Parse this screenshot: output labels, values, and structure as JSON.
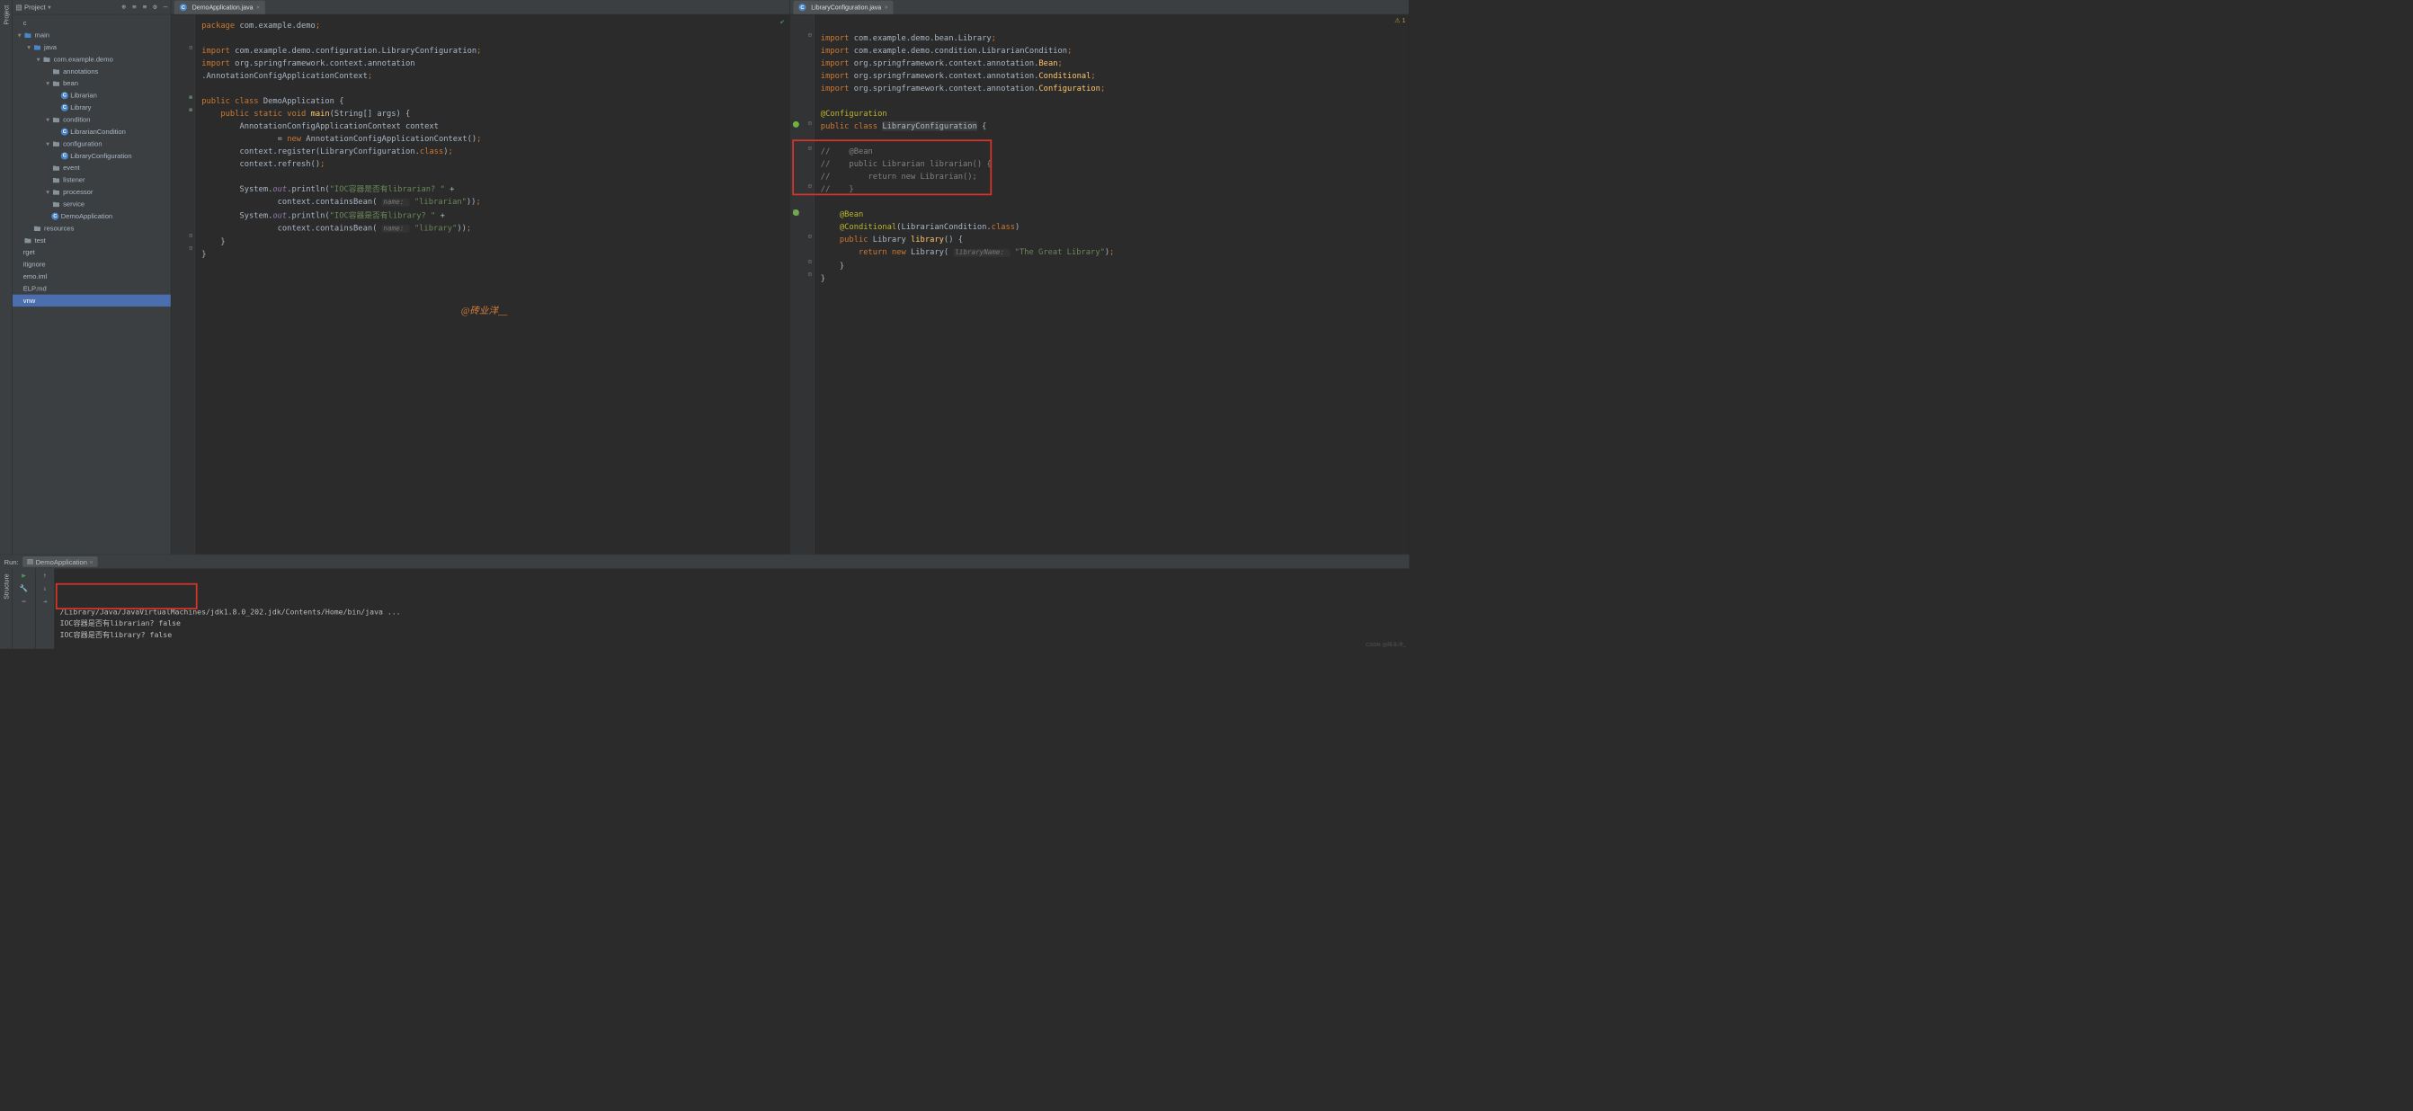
{
  "project": {
    "label": "Project",
    "tree": [
      {
        "indent": 0,
        "arrow": "",
        "icon": "",
        "label": "c"
      },
      {
        "indent": 0,
        "arrow": "▾",
        "icon": "folder-blue",
        "label": "main"
      },
      {
        "indent": 1,
        "arrow": "▾",
        "icon": "folder-blue",
        "label": "java"
      },
      {
        "indent": 2,
        "arrow": "▾",
        "icon": "folder",
        "label": "com.example.demo"
      },
      {
        "indent": 3,
        "arrow": "",
        "icon": "folder",
        "label": "annotations"
      },
      {
        "indent": 3,
        "arrow": "▾",
        "icon": "folder",
        "label": "bean"
      },
      {
        "indent": 4,
        "arrow": "",
        "icon": "class",
        "label": "Librarian"
      },
      {
        "indent": 4,
        "arrow": "",
        "icon": "class",
        "label": "Library"
      },
      {
        "indent": 3,
        "arrow": "▾",
        "icon": "folder",
        "label": "condition"
      },
      {
        "indent": 4,
        "arrow": "",
        "icon": "class",
        "label": "LibrarianCondition"
      },
      {
        "indent": 3,
        "arrow": "▾",
        "icon": "folder",
        "label": "configuration"
      },
      {
        "indent": 4,
        "arrow": "",
        "icon": "class",
        "label": "LibraryConfiguration"
      },
      {
        "indent": 3,
        "arrow": "",
        "icon": "folder",
        "label": "event"
      },
      {
        "indent": 3,
        "arrow": "",
        "icon": "folder",
        "label": "listener"
      },
      {
        "indent": 3,
        "arrow": "▾",
        "icon": "folder",
        "label": "processor"
      },
      {
        "indent": 3,
        "arrow": "",
        "icon": "folder",
        "label": "service"
      },
      {
        "indent": 3,
        "arrow": "",
        "icon": "class",
        "label": "DemoApplication"
      },
      {
        "indent": 1,
        "arrow": "",
        "icon": "folder",
        "label": "resources"
      },
      {
        "indent": 0,
        "arrow": "",
        "icon": "folder",
        "label": "test"
      },
      {
        "indent": 0,
        "arrow": "",
        "icon": "",
        "label": "rget"
      },
      {
        "indent": 0,
        "arrow": "",
        "icon": "",
        "label": "itignore"
      },
      {
        "indent": 0,
        "arrow": "",
        "icon": "",
        "label": "emo.iml"
      },
      {
        "indent": 0,
        "arrow": "",
        "icon": "",
        "label": "ELP.md"
      },
      {
        "indent": 0,
        "arrow": "",
        "icon": "",
        "label": "vnw",
        "selected": true
      }
    ]
  },
  "tabs": {
    "left": "DemoApplication.java",
    "right": "LibraryConfiguration.java"
  },
  "editor_left": {
    "lines": [
      [
        {
          "t": "package ",
          "c": "kw"
        },
        {
          "t": "com.example.demo",
          "c": ""
        },
        {
          "t": ";",
          "c": "kw"
        }
      ],
      [],
      [
        {
          "t": "import ",
          "c": "kw"
        },
        {
          "t": "com.example.demo.configuration.LibraryConfiguration",
          "c": ""
        },
        {
          "t": ";",
          "c": "kw"
        }
      ],
      [
        {
          "t": "import ",
          "c": "kw"
        },
        {
          "t": "org.springframework.context.annotation",
          "c": ""
        }
      ],
      [
        {
          "t": ".AnnotationConfigApplicationContext",
          "c": ""
        },
        {
          "t": ";",
          "c": "kw"
        }
      ],
      [],
      [
        {
          "t": "public class ",
          "c": "kw"
        },
        {
          "t": "DemoApplication {",
          "c": ""
        }
      ],
      [
        {
          "t": "    public static void ",
          "c": "kw"
        },
        {
          "t": "main",
          "c": "fn"
        },
        {
          "t": "(String[] args) {",
          "c": ""
        }
      ],
      [
        {
          "t": "        AnnotationConfigApplicationContext context",
          "c": ""
        }
      ],
      [
        {
          "t": "                = ",
          "c": ""
        },
        {
          "t": "new ",
          "c": "kw"
        },
        {
          "t": "AnnotationConfigApplicationContext()",
          "c": ""
        },
        {
          "t": ";",
          "c": "kw"
        }
      ],
      [
        {
          "t": "        context.register(LibraryConfiguration.",
          "c": ""
        },
        {
          "t": "class",
          "c": "kw"
        },
        {
          "t": ")",
          "c": ""
        },
        {
          "t": ";",
          "c": "kw"
        }
      ],
      [
        {
          "t": "        context.refresh()",
          "c": ""
        },
        {
          "t": ";",
          "c": "kw"
        }
      ],
      [],
      [
        {
          "t": "        System.",
          "c": ""
        },
        {
          "t": "out",
          "c": "field-it"
        },
        {
          "t": ".println(",
          "c": ""
        },
        {
          "t": "\"IOC容器是否有librarian? \" ",
          "c": "str"
        },
        {
          "t": "+",
          "c": ""
        }
      ],
      [
        {
          "t": "                context.containsBean( ",
          "c": ""
        },
        {
          "t": "name: ",
          "c": "hint"
        },
        {
          "t": " ",
          "c": ""
        },
        {
          "t": "\"librarian\"",
          "c": "str"
        },
        {
          "t": "))",
          "c": ""
        },
        {
          "t": ";",
          "c": "kw"
        }
      ],
      [
        {
          "t": "        System.",
          "c": ""
        },
        {
          "t": "out",
          "c": "field-it"
        },
        {
          "t": ".println(",
          "c": ""
        },
        {
          "t": "\"IOC容器是否有library? \" ",
          "c": "str"
        },
        {
          "t": "+",
          "c": ""
        }
      ],
      [
        {
          "t": "                context.containsBean( ",
          "c": ""
        },
        {
          "t": "name: ",
          "c": "hint"
        },
        {
          "t": " ",
          "c": ""
        },
        {
          "t": "\"library\"",
          "c": "str"
        },
        {
          "t": "))",
          "c": ""
        },
        {
          "t": ";",
          "c": "kw"
        }
      ],
      [
        {
          "t": "    }",
          "c": ""
        }
      ],
      [
        {
          "t": "}",
          "c": ""
        }
      ]
    ]
  },
  "editor_right": {
    "warn": "1",
    "lines": [
      [],
      [
        {
          "t": "import ",
          "c": "kw"
        },
        {
          "t": "com.example.demo.bean.Library",
          "c": ""
        },
        {
          "t": ";",
          "c": "kw"
        }
      ],
      [
        {
          "t": "import ",
          "c": "kw"
        },
        {
          "t": "com.example.demo.condition.LibrarianCondition",
          "c": ""
        },
        {
          "t": ";",
          "c": "kw"
        }
      ],
      [
        {
          "t": "import ",
          "c": "kw"
        },
        {
          "t": "org.springframework.context.annotation.",
          "c": ""
        },
        {
          "t": "Bean",
          "c": "fn"
        },
        {
          "t": ";",
          "c": "kw"
        }
      ],
      [
        {
          "t": "import ",
          "c": "kw"
        },
        {
          "t": "org.springframework.context.annotation.",
          "c": ""
        },
        {
          "t": "Conditional",
          "c": "fn"
        },
        {
          "t": ";",
          "c": "kw"
        }
      ],
      [
        {
          "t": "import ",
          "c": "kw"
        },
        {
          "t": "org.springframework.context.annotation.",
          "c": ""
        },
        {
          "t": "Configuration",
          "c": "fn"
        },
        {
          "t": ";",
          "c": "kw"
        }
      ],
      [],
      [
        {
          "t": "@Configuration",
          "c": "ann"
        }
      ],
      [
        {
          "t": "public class ",
          "c": "kw"
        },
        {
          "t": "LibraryConfiguration",
          "c": "cls-hl"
        },
        {
          "t": " {",
          "c": ""
        }
      ],
      [],
      [
        {
          "t": "//    @Bean",
          "c": "cmt"
        }
      ],
      [
        {
          "t": "//    public Librarian librarian() {",
          "c": "cmt"
        }
      ],
      [
        {
          "t": "//        return new Librarian();",
          "c": "cmt"
        }
      ],
      [
        {
          "t": "//    }",
          "c": "cmt"
        }
      ],
      [],
      [
        {
          "t": "    ",
          "c": ""
        },
        {
          "t": "@Bean",
          "c": "ann"
        }
      ],
      [
        {
          "t": "    ",
          "c": ""
        },
        {
          "t": "@Conditional",
          "c": "ann"
        },
        {
          "t": "(LibrarianCondition.",
          "c": ""
        },
        {
          "t": "class",
          "c": "kw"
        },
        {
          "t": ")",
          "c": ""
        }
      ],
      [
        {
          "t": "    ",
          "c": ""
        },
        {
          "t": "public ",
          "c": "kw"
        },
        {
          "t": "Library ",
          "c": ""
        },
        {
          "t": "library",
          "c": "fn"
        },
        {
          "t": "() {",
          "c": ""
        }
      ],
      [
        {
          "t": "        ",
          "c": ""
        },
        {
          "t": "return new ",
          "c": "kw"
        },
        {
          "t": "Library( ",
          "c": ""
        },
        {
          "t": "libraryName: ",
          "c": "hint"
        },
        {
          "t": " ",
          "c": ""
        },
        {
          "t": "\"The Great Library\"",
          "c": "str"
        },
        {
          "t": ")",
          "c": ""
        },
        {
          "t": ";",
          "c": "kw"
        }
      ],
      [
        {
          "t": "    }",
          "c": ""
        }
      ],
      [
        {
          "t": "}",
          "c": ""
        }
      ]
    ]
  },
  "run": {
    "title": "Run:",
    "config": "DemoApplication",
    "console": [
      "/Library/Java/JavaVirtualMachines/jdk1.8.0_202.jdk/Contents/Home/bin/java ...",
      "IOC容器是否有librarian? false",
      "IOC容器是否有library? false"
    ]
  },
  "watermark": "@砖业洋__",
  "csdn": "CSDN @砖业洋_",
  "structure_label": "Structure",
  "project_label": "Project"
}
